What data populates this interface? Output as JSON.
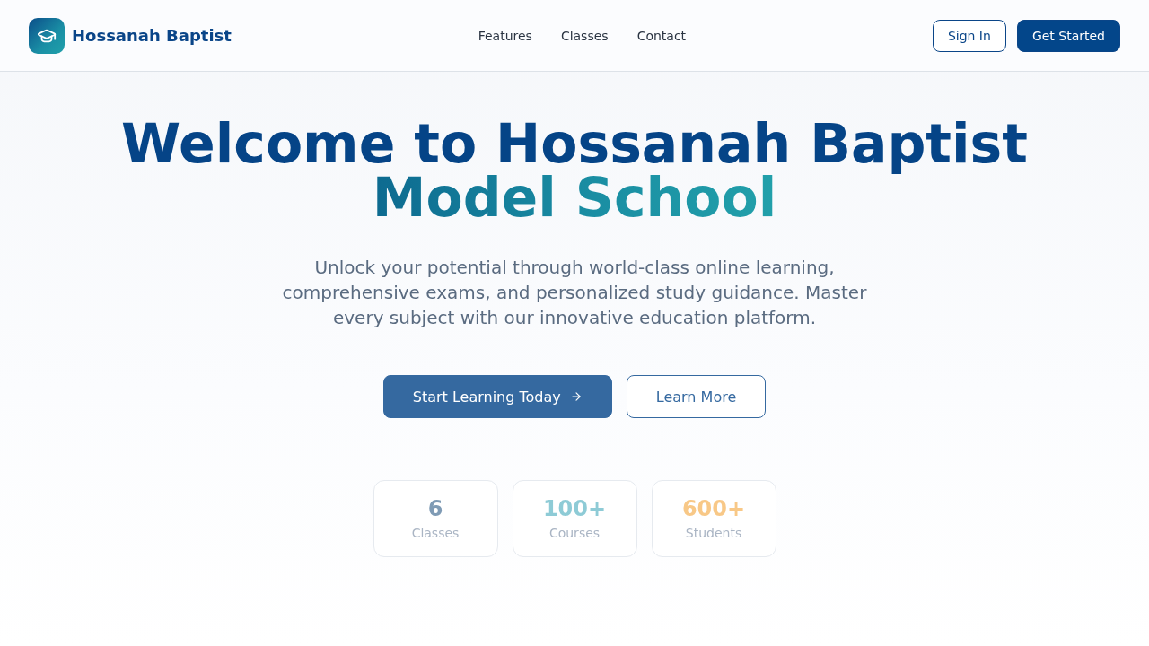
{
  "header": {
    "brand": "Hossanah Baptist",
    "nav": [
      "Features",
      "Classes",
      "Contact"
    ],
    "buttons": [
      {
        "label": "Sign In",
        "kind": "outline"
      },
      {
        "label": "Get Started",
        "kind": "solid"
      }
    ]
  },
  "hero": {
    "title": "Welcome to Hossanah Baptist",
    "title_highlight": "Model School",
    "subtitle": "Unlock your potential through world-class online learning, comprehensive exams, and personalized study guidance. Master every subject with our innovative education platform.",
    "actions": [
      {
        "label": "Start Learning Today",
        "kind": "primary"
      },
      {
        "label": "Learn More",
        "kind": "outline"
      }
    ],
    "stats": [
      {
        "value": "6",
        "label": "Classes",
        "color": "#7f9bb5"
      },
      {
        "value": "100+",
        "label": "Courses",
        "color": "#8ecbd6"
      },
      {
        "value": "600+",
        "label": "Students",
        "color": "#f8c887"
      }
    ]
  }
}
